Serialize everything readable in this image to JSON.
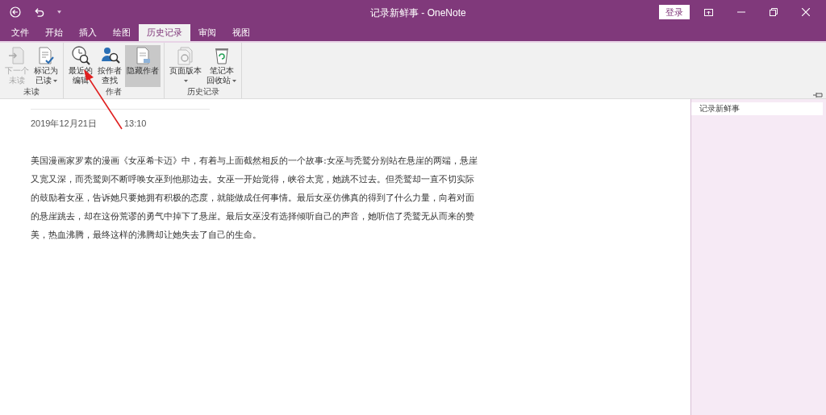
{
  "window": {
    "title": "记录新鲜事 - OneNote",
    "sign_in": "登录"
  },
  "tabs": [
    {
      "label": "文件",
      "selected": false
    },
    {
      "label": "开始",
      "selected": false
    },
    {
      "label": "插入",
      "selected": false
    },
    {
      "label": "绘图",
      "selected": false
    },
    {
      "label": "历史记录",
      "selected": true
    },
    {
      "label": "审阅",
      "selected": false
    },
    {
      "label": "视图",
      "selected": false
    }
  ],
  "ribbon_groups": [
    {
      "label": "未读",
      "buttons": [
        {
          "lines": [
            "下一个",
            "未读"
          ],
          "disabled": true,
          "selected": false,
          "menu": false
        },
        {
          "lines": [
            "标记为",
            "已读"
          ],
          "disabled": false,
          "selected": false,
          "menu": true
        }
      ]
    },
    {
      "label": "作者",
      "buttons": [
        {
          "lines": [
            "最近的",
            "编辑"
          ],
          "disabled": false,
          "selected": false,
          "menu": false
        },
        {
          "lines": [
            "按作者",
            "查找"
          ],
          "disabled": false,
          "selected": false,
          "menu": false
        },
        {
          "lines": [
            "隐藏作者"
          ],
          "disabled": false,
          "selected": true,
          "menu": false
        }
      ]
    },
    {
      "label": "历史记录",
      "buttons": [
        {
          "lines": [
            "页面版本"
          ],
          "disabled": false,
          "selected": false,
          "menu": true
        },
        {
          "lines": [
            "笔记本",
            "回收站"
          ],
          "disabled": false,
          "selected": false,
          "menu": true
        }
      ]
    }
  ],
  "page": {
    "date": "2019年12月21日",
    "time": "13:10",
    "body": "美国漫画家罗素的漫画《女巫希卡迈》中，有着与上面截然相反的一个故事:女巫与秃鹫分别站在悬崖的两端，悬崖又宽又深，而秃鹫则不断呼唤女巫到他那边去。女巫一开始觉得，峡谷太宽，她跳不过去。但秃鹫却一直不切实际的鼓励着女巫，告诉她只要她拥有积极的态度，就能做成任何事情。最后女巫仿佛真的得到了什么力量，向着对面的悬崖跳去，却在这份荒谬的勇气中掉下了悬崖。最后女巫没有选择倾听自己的声音，她听信了秃鹫无从而来的赞美，热血沸腾，最终这样的沸腾却让她失去了自己的生命。"
  },
  "page_list": [
    {
      "label": "记录新鲜事",
      "selected": true
    }
  ]
}
